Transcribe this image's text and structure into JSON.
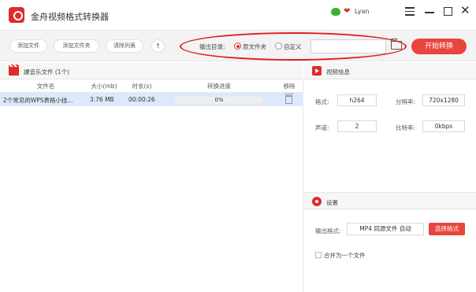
{
  "app": {
    "title": "金舟视频格式转换器",
    "user": "Lyan"
  },
  "toolbar": {
    "add_file": "添加文件",
    "add_folder": "添加文件夹",
    "clear_list": "清除列表",
    "move_up": "↑",
    "output_label": "输出目录:",
    "option_source": "原文件夹",
    "option_custom": "自定义",
    "path_value": "",
    "start_label": "开始转换"
  },
  "file_list": {
    "title": "課音乐文件 (1个)",
    "columns": [
      "文件名",
      "大小(mb)",
      "时长(s)",
      "转换进度",
      "移除"
    ],
    "rows": [
      {
        "name": "2个常见的WPS表格小技...",
        "size": "3.76 MB",
        "duration": "00:00:26",
        "progress": "0%"
      }
    ]
  },
  "video_info": {
    "title": "视频信息",
    "format_label": "格式:",
    "format_value": "h264",
    "resolution_label": "分辨率:",
    "resolution_value": "720x1280",
    "channel_label": "声道:",
    "channel_value": "2",
    "bitrate_label": "比特率:",
    "bitrate_value": "0kbps"
  },
  "settings": {
    "title": "设置",
    "output_format_label": "输出格式:",
    "output_format_value": "MP4 同源文件 自动",
    "choose_format": "选择格式",
    "merge_label": "合并为一个文件"
  },
  "colors": {
    "accent": "#e8453c",
    "selected_row": "#dde9fa"
  }
}
